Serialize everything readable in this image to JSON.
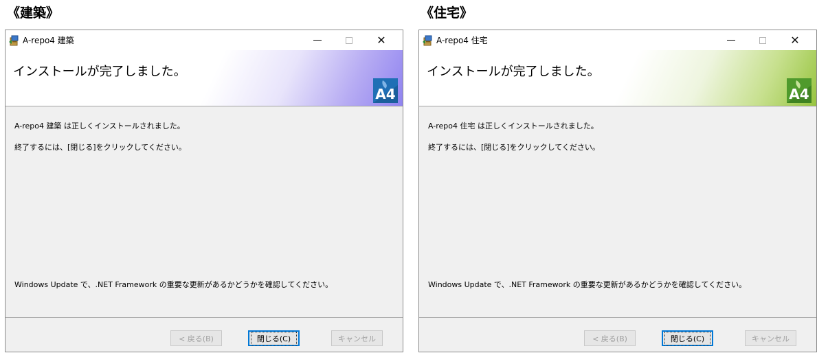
{
  "windows": [
    {
      "section_title": "《建築》",
      "title": "A-repo4 建築",
      "heading": "インストールが完了しました。",
      "line1": "A-repo4 建築 は正しくインストールされました。",
      "line2": "終了するには、[閉じる]をクリックしてください。",
      "line3": "Windows Update で、.NET Framework の重要な更新があるかどうかを確認してください。",
      "back_label": "< 戻る(B)",
      "close_label": "閉じる(C)",
      "cancel_label": "キャンセル",
      "logo_text": "A4",
      "accent": "#8f83f0"
    },
    {
      "section_title": "《住宅》",
      "title": "A-repo4 住宅",
      "heading": "インストールが完了しました。",
      "line1": "A-repo4 住宅 は正しくインストールされました。",
      "line2": "終了するには、[閉じる]をクリックしてください。",
      "line3": "Windows Update で、.NET Framework の重要な更新があるかどうかを確認してください。",
      "back_label": "< 戻る(B)",
      "close_label": "閉じる(C)",
      "cancel_label": "キャンセル",
      "logo_text": "A4",
      "accent": "#97c43f"
    }
  ],
  "controls": {
    "minimize": "—",
    "close": "✕"
  }
}
